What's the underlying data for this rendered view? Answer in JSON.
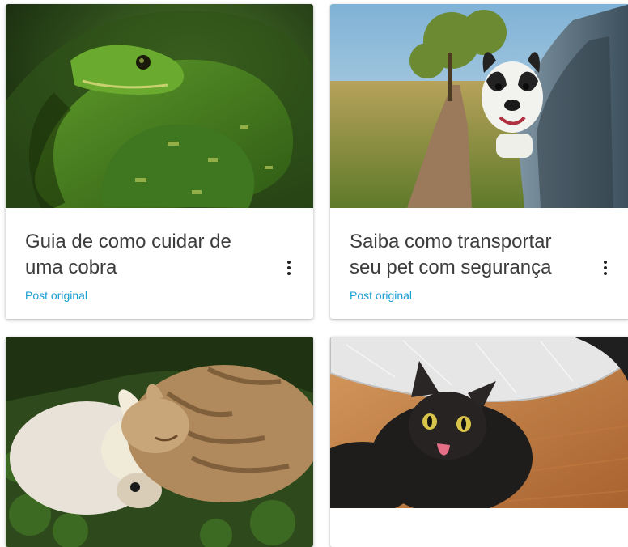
{
  "cards": [
    {
      "title": "Guia de como cuidar de uma cobra",
      "link_label": "Post original",
      "image": "green python coiled on branch"
    },
    {
      "title": "Saiba como transportar seu pet com segurança",
      "link_label": "Post original",
      "image": "french bulldog looking out of car window"
    },
    {
      "title": "",
      "link_label": "",
      "image": "cat and puppy cuddling on grass"
    },
    {
      "title": "",
      "link_label": "",
      "image": "black cat licking lips under car"
    }
  ],
  "colors": {
    "link": "#1a9fd0",
    "title": "#3c3c3c"
  },
  "icons": {
    "more": "more-vert-icon"
  }
}
